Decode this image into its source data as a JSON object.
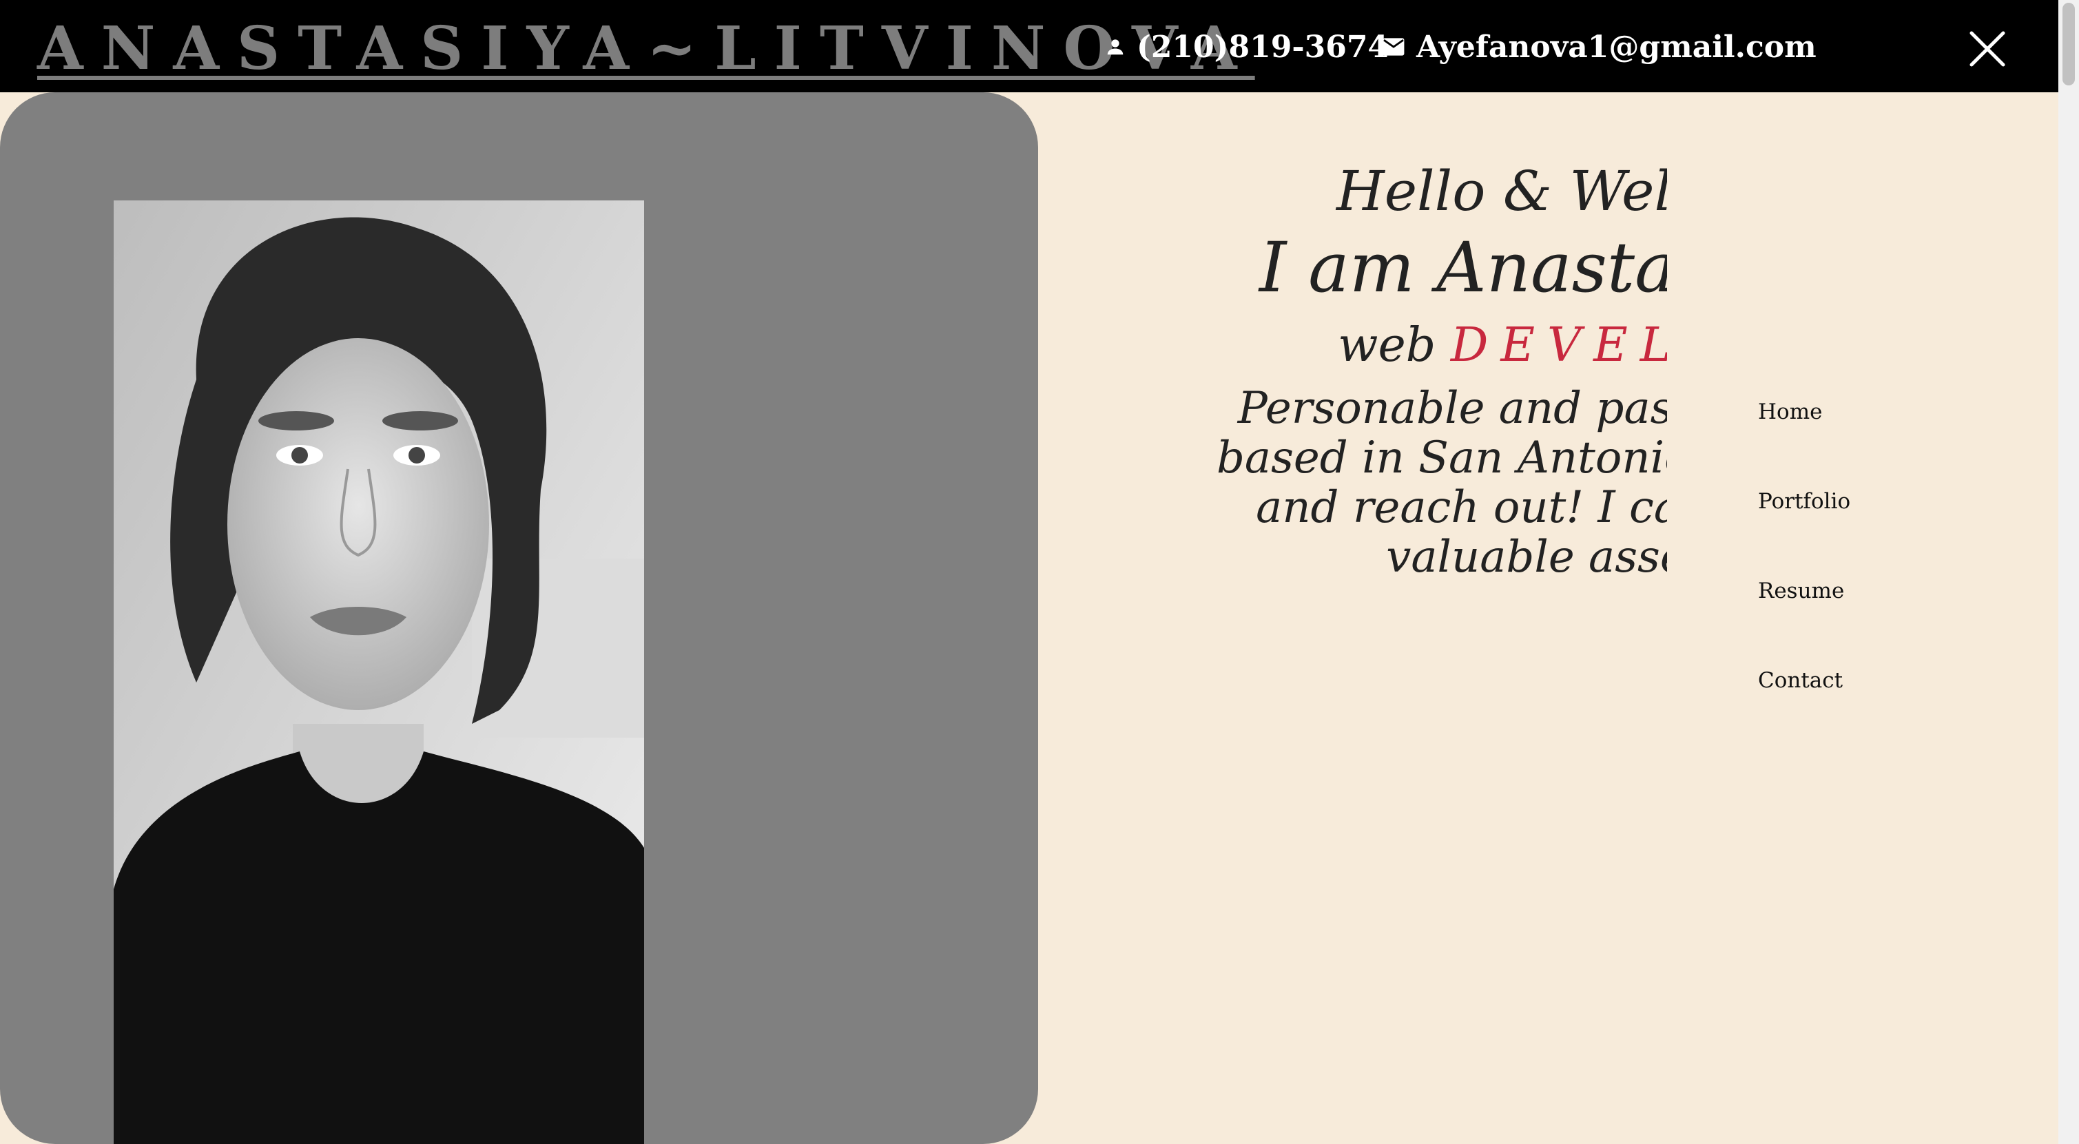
{
  "header": {
    "brand": "ANASTASIYA~LITVINOVA",
    "phone": "(210)819-3674",
    "email": "Ayefanova1@gmail.com",
    "phone_icon": "person-icon",
    "email_icon": "envelope-icon",
    "close_icon": "close-icon"
  },
  "hero": {
    "greeting": "Hello & Welco",
    "intro": "I am Anastasiya",
    "role_prefix": "web",
    "role_accent": "DEVELO",
    "bio": [
      "Personable and passionate",
      "based in San Antonio,TX. Ch",
      "and reach out! I can't wa",
      "valuable asse"
    ],
    "accent_color": "#c8283e"
  },
  "nav": {
    "items": [
      "Home",
      "Portfolio",
      "Resume",
      "Contact"
    ]
  },
  "colors": {
    "topbar": "#000000",
    "background": "#f7ebda",
    "photo_panel": "#808080"
  }
}
